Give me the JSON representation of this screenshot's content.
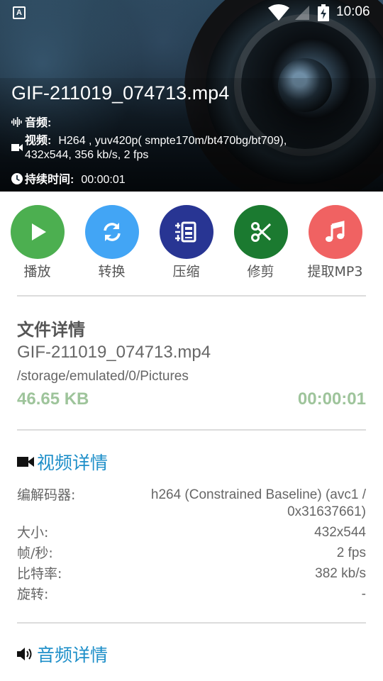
{
  "status_bar": {
    "time": "10:06",
    "app_icon_letter": "A"
  },
  "file": {
    "title": "GIF-211019_074713.mp4",
    "audio_label": "音频:",
    "video_label": "视频:",
    "video_info_line1": "H264 , yuv420p( smpte170m/bt470bg/bt709),",
    "video_info_line2": "432x544, 356 kb/s, 2 fps",
    "duration_label": "持续时间:",
    "duration_value": "00:00:01"
  },
  "actions": [
    {
      "label": "播放",
      "icon": "play-icon",
      "color": "#4caf50"
    },
    {
      "label": "转换",
      "icon": "convert-icon",
      "color": "#42a5f5"
    },
    {
      "label": "压缩",
      "icon": "compress-icon",
      "color": "#283593"
    },
    {
      "label": "修剪",
      "icon": "scissors-icon",
      "color": "#1b7a30"
    },
    {
      "label": "提取MP3",
      "icon": "music-note-icon",
      "color": "#f06262"
    }
  ],
  "file_details": {
    "title": "文件详情",
    "name": "GIF-211019_074713.mp4",
    "path": "/storage/emulated/0/Pictures",
    "size": "46.65 KB",
    "duration": "00:00:01"
  },
  "video_details": {
    "title": "视频详情",
    "rows": [
      {
        "key": "编解码器:",
        "value": "h264 (Constrained Baseline) (avc1 / 0x31637661)"
      },
      {
        "key": "大小:",
        "value": "432x544"
      },
      {
        "key": "帧/秒:",
        "value": "2 fps"
      },
      {
        "key": "比特率:",
        "value": "382 kb/s"
      },
      {
        "key": "旋转:",
        "value": "-"
      }
    ]
  },
  "audio_details": {
    "title": "音频详情"
  },
  "colors": {
    "accent_blue": "#1e8fc9",
    "accent_green": "#9ec49b"
  }
}
